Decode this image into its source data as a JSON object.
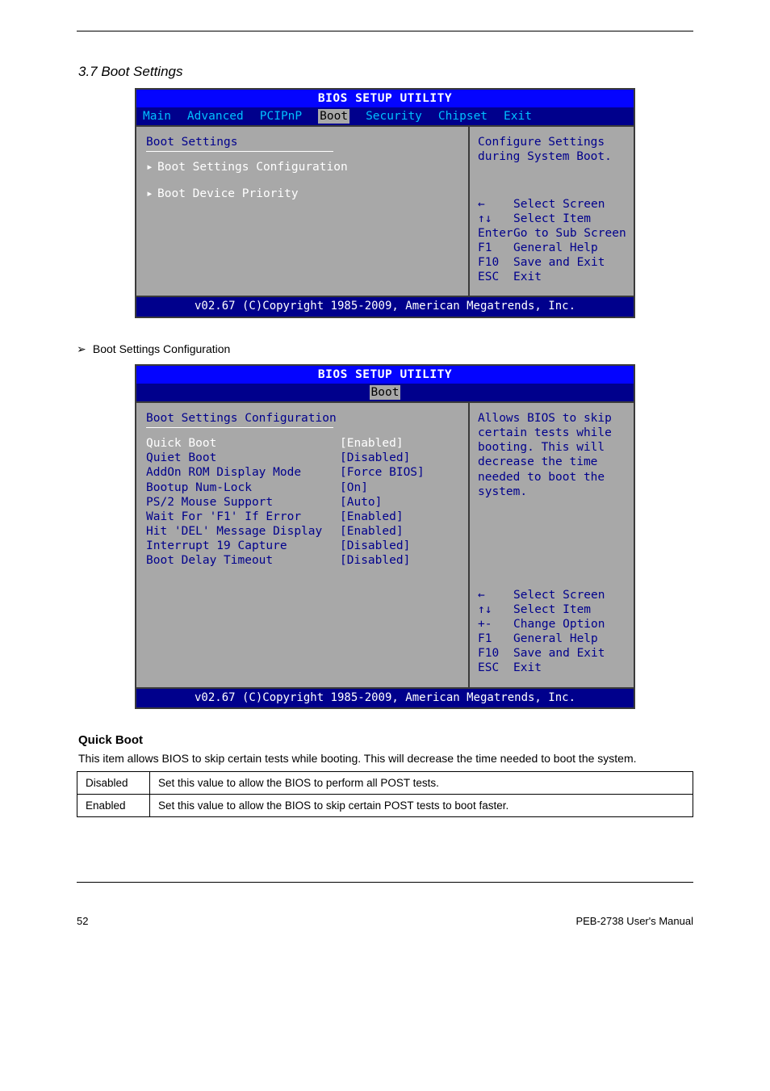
{
  "section_number": "3.7 Boot Settings",
  "bios1": {
    "title": "BIOS SETUP UTILITY",
    "tabs": [
      "Main",
      "Advanced",
      "PCIPnP",
      "Boot",
      "Security",
      "Chipset",
      "Exit"
    ],
    "active_tab": "Boot",
    "heading": "Boot Settings",
    "items": [
      "Boot Settings Configuration",
      "Boot Device Priority"
    ],
    "help": "Configure Settings during System Boot.",
    "keys": [
      {
        "k": "←",
        "d": "Select Screen"
      },
      {
        "k": "↑↓",
        "d": "Select Item"
      },
      {
        "k": "Enter",
        "d": "Go to Sub Screen"
      },
      {
        "k": "F1",
        "d": "General Help"
      },
      {
        "k": "F10",
        "d": "Save and Exit"
      },
      {
        "k": "ESC",
        "d": "Exit"
      }
    ],
    "footer": "v02.67 (C)Copyright 1985-2009, American Megatrends, Inc."
  },
  "sub_bullet": "Boot Settings Configuration",
  "bios2": {
    "title": "BIOS SETUP UTILITY",
    "active_tab": "Boot",
    "heading": "Boot Settings Configuration",
    "rows": [
      {
        "l": "Quick Boot",
        "v": "[Enabled]"
      },
      {
        "l": "Quiet Boot",
        "v": "[Disabled]"
      },
      {
        "l": "AddOn ROM Display Mode",
        "v": "[Force BIOS]"
      },
      {
        "l": "Bootup Num-Lock",
        "v": "[On]"
      },
      {
        "l": "PS/2 Mouse Support",
        "v": "[Auto]"
      },
      {
        "l": "Wait For 'F1' If Error",
        "v": "[Enabled]"
      },
      {
        "l": "Hit 'DEL' Message Display",
        "v": "[Enabled]"
      },
      {
        "l": "Interrupt 19 Capture",
        "v": "[Disabled]"
      },
      {
        "l": "Boot Delay Timeout",
        "v": "[Disabled]"
      }
    ],
    "help": "Allows BIOS to skip certain tests while booting. This will decrease the time needed to boot the system.",
    "keys": [
      {
        "k": "←",
        "d": "Select Screen"
      },
      {
        "k": "↑↓",
        "d": "Select Item"
      },
      {
        "k": "+-",
        "d": "Change Option"
      },
      {
        "k": "F1",
        "d": "General Help"
      },
      {
        "k": "F10",
        "d": "Save and Exit"
      },
      {
        "k": "ESC",
        "d": "Exit"
      }
    ],
    "footer": "v02.67 (C)Copyright 1985-2009, American Megatrends, Inc."
  },
  "quickboot": {
    "label": "Quick Boot",
    "desc": "This item allows BIOS to skip certain tests while booting. This will decrease the time needed to boot the system.",
    "rows": [
      {
        "k": "Disabled",
        "d": "Set this value to allow the BIOS to perform all POST tests."
      },
      {
        "k": "Enabled",
        "d": "Set this value to allow the BIOS to skip certain POST tests to boot faster."
      }
    ]
  },
  "page_footer_left": "52",
  "page_footer_right": "PEB-2738 User's Manual"
}
